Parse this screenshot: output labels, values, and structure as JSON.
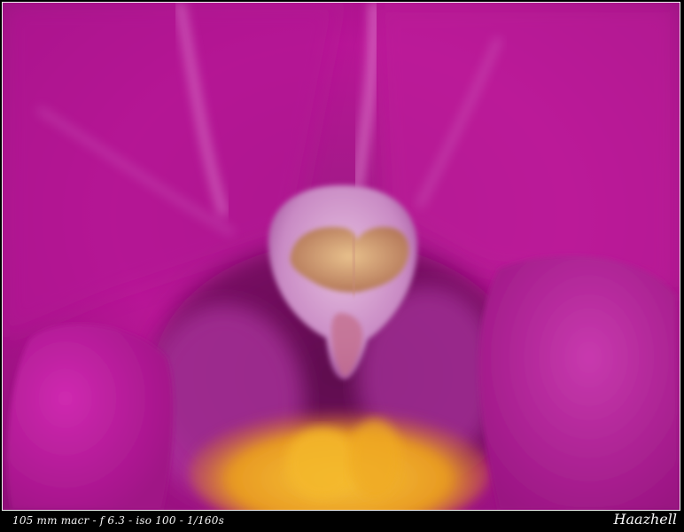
{
  "photo": {
    "subject": "orchid-flower-macro",
    "colors": {
      "petal": "#c0129a",
      "petal_light": "#d86ac8",
      "column": "#d9a6d6",
      "anther": "#d8a470",
      "lip_yellow": "#f2b52a"
    }
  },
  "caption": {
    "exif": "105 mm macr - f 6.3 - iso 100 - 1/160s",
    "signature": "Haazhell"
  }
}
